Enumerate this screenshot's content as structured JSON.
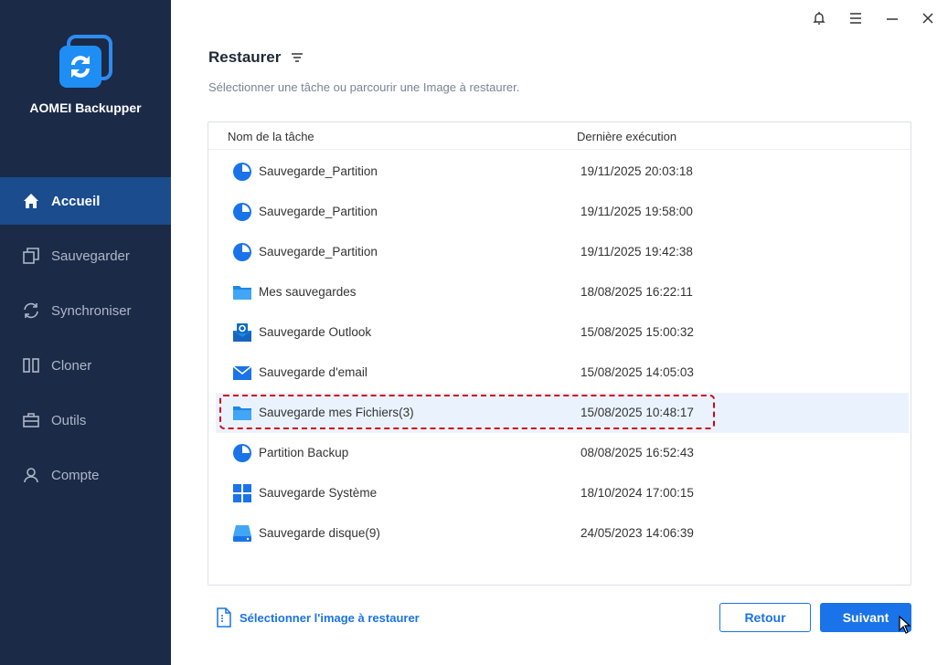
{
  "app": {
    "name": "AOMEI Backupper"
  },
  "sidebar": {
    "items": [
      {
        "label": "Accueil",
        "icon": "home-icon",
        "active": true
      },
      {
        "label": "Sauvegarder",
        "icon": "backup-icon"
      },
      {
        "label": "Synchroniser",
        "icon": "sync-icon"
      },
      {
        "label": "Cloner",
        "icon": "clone-icon"
      },
      {
        "label": "Outils",
        "icon": "tools-icon"
      },
      {
        "label": "Compte",
        "icon": "user-icon"
      }
    ]
  },
  "window_controls": [
    "bell-icon",
    "menu-icon",
    "minimize-icon",
    "close-icon"
  ],
  "main": {
    "title": "Restaurer",
    "subtitle": "Sélectionner une tâche ou parcourir une Image à restaurer."
  },
  "table": {
    "columns": [
      "Nom de la tâche",
      "Dernière exécution"
    ],
    "rows": [
      {
        "name": "Sauvegarde_Partition",
        "date": "19/11/2025 20:03:18",
        "icon": "partition-icon"
      },
      {
        "name": "Sauvegarde_Partition",
        "date": "19/11/2025 19:58:00",
        "icon": "partition-icon"
      },
      {
        "name": "Sauvegarde_Partition",
        "date": "19/11/2025 19:42:38",
        "icon": "partition-icon"
      },
      {
        "name": "Mes sauvegardes",
        "date": "18/08/2025 16:22:11",
        "icon": "folder-icon"
      },
      {
        "name": "Sauvegarde Outlook",
        "date": "15/08/2025 15:00:32",
        "icon": "outlook-icon"
      },
      {
        "name": "Sauvegarde d'email",
        "date": "15/08/2025 14:05:03",
        "icon": "email-icon"
      },
      {
        "name": "Sauvegarde mes Fichiers(3)",
        "date": "15/08/2025 10:48:17",
        "icon": "folder-icon",
        "selected": true
      },
      {
        "name": "Partition Backup",
        "date": "08/08/2025 16:52:43",
        "icon": "partition-icon"
      },
      {
        "name": "Sauvegarde Système",
        "date": "18/10/2024 17:00:15",
        "icon": "windows-icon"
      },
      {
        "name": "Sauvegarde disque(9)",
        "date": "24/05/2023 14:06:39",
        "icon": "disk-icon"
      }
    ]
  },
  "footer": {
    "select_image_label": "Sélectionner l'image à restaurer",
    "back_label": "Retour",
    "next_label": "Suivant"
  },
  "colors": {
    "sidebar_bg": "#1b2a47",
    "sidebar_active": "#1a4c8e",
    "accent": "#1a73e8",
    "highlight_border": "#d0021b"
  }
}
